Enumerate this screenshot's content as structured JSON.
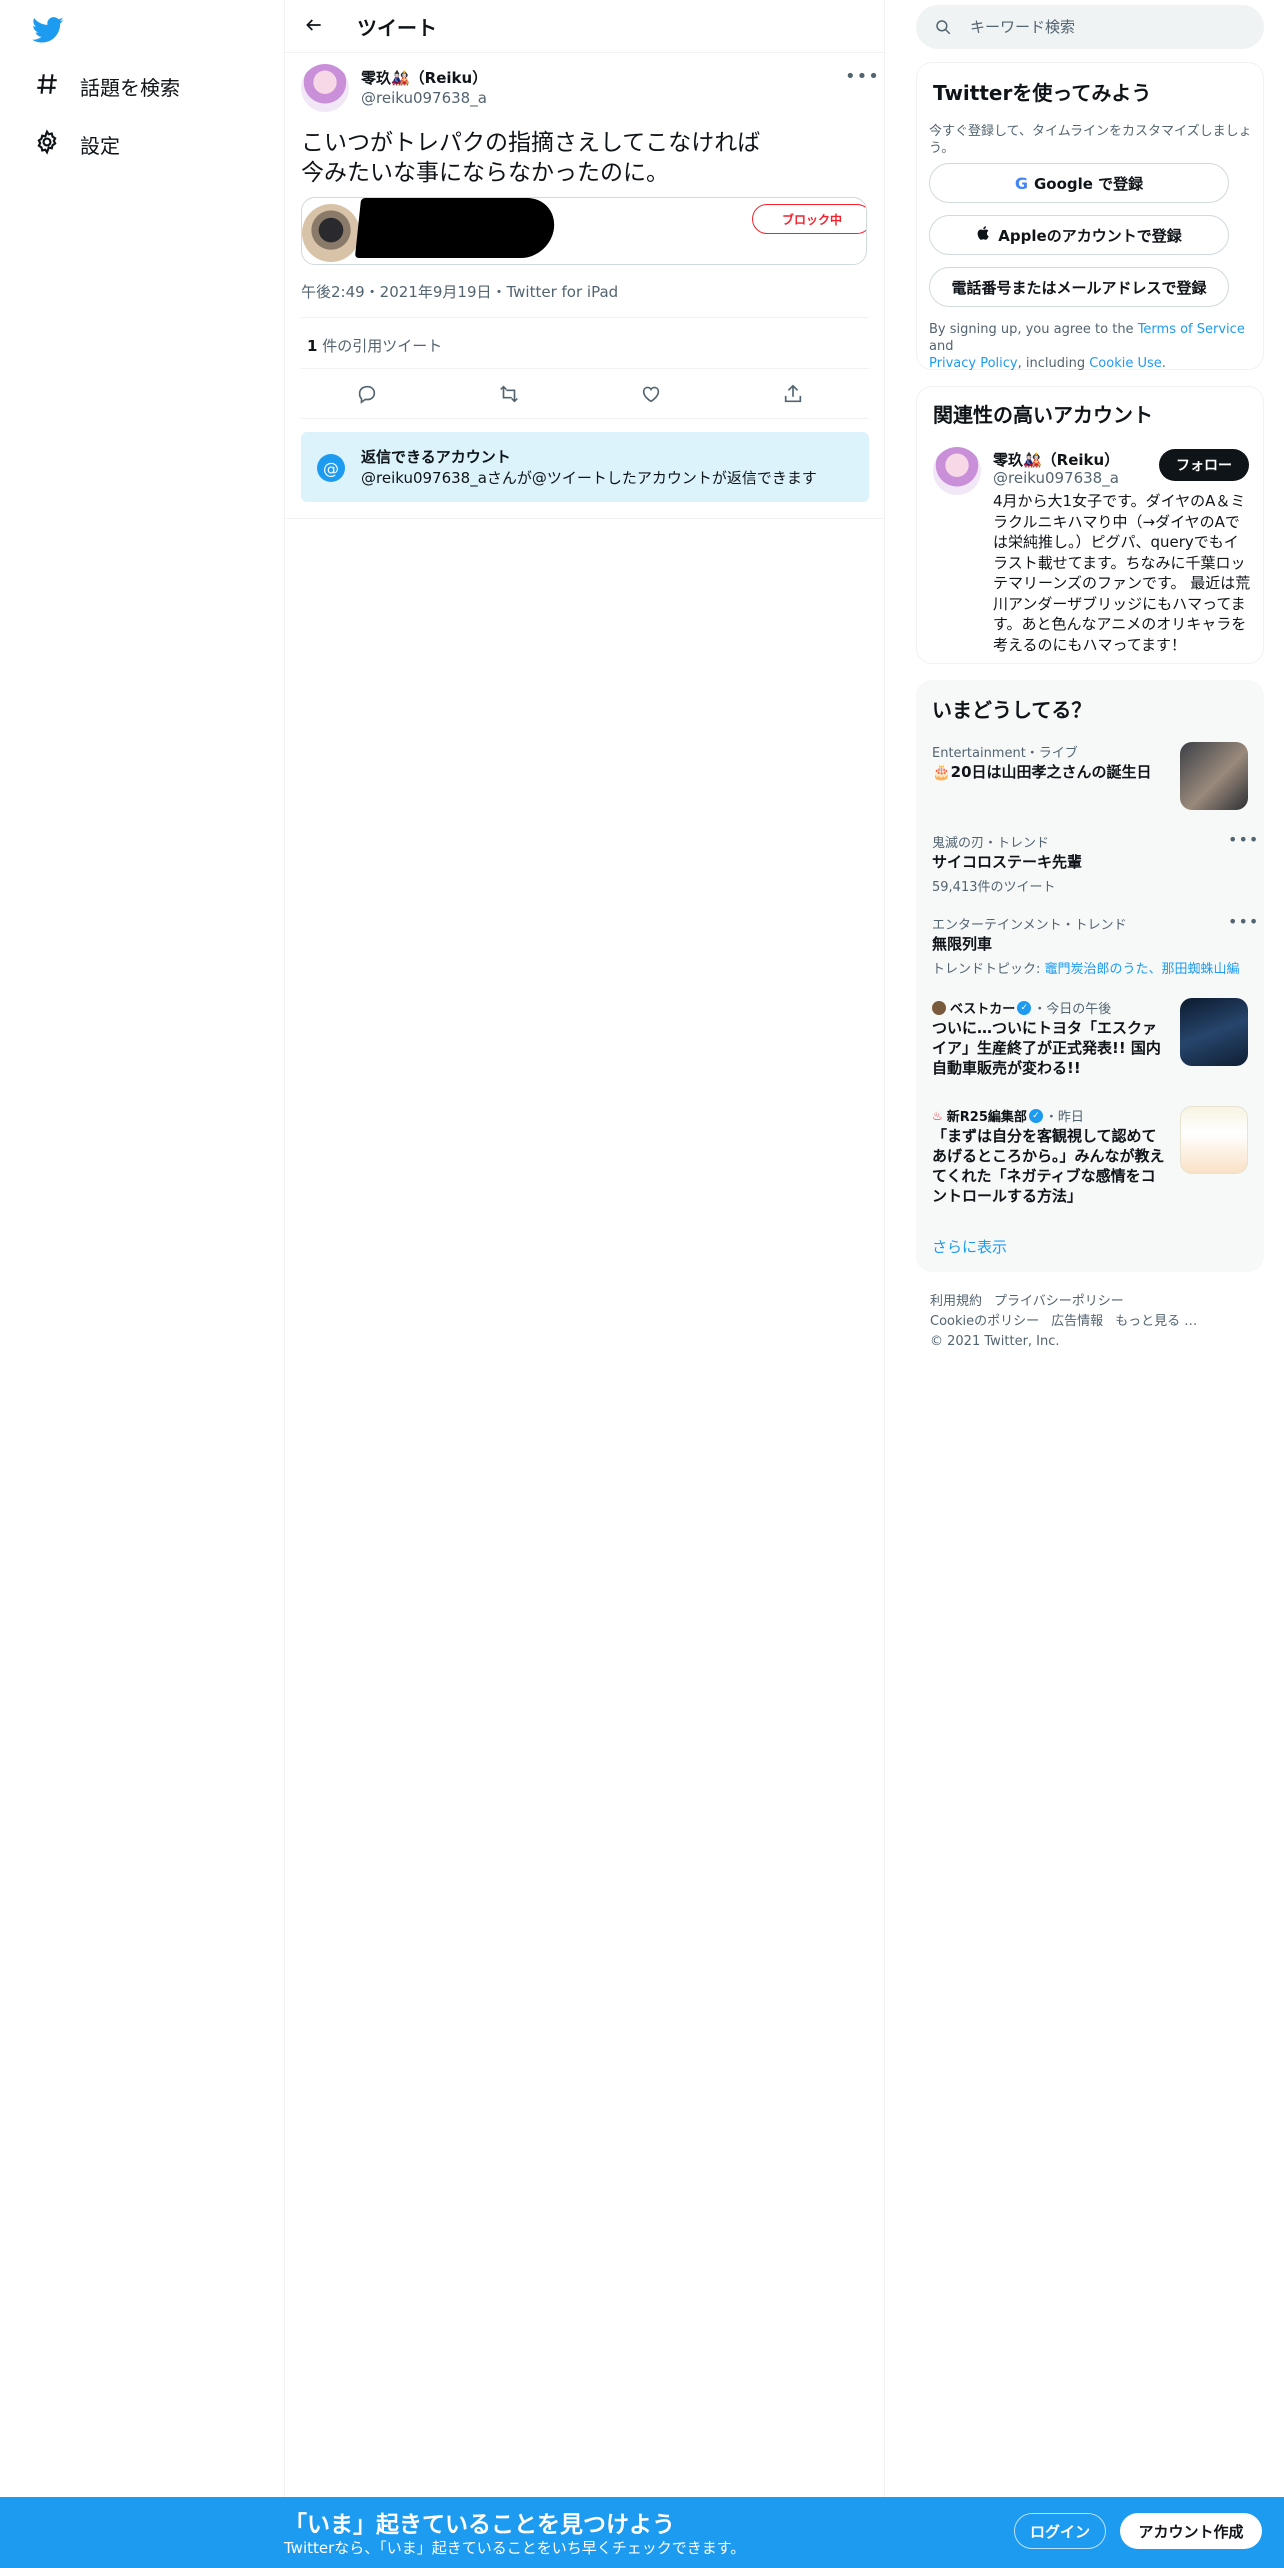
{
  "nav": {
    "explore_label": "話題を検索",
    "settings_label": "設定"
  },
  "header": {
    "title": "ツイート"
  },
  "tweet": {
    "name": "零玖🎎（Reiku）",
    "handle": "@reiku097638_a",
    "text": "こいつがトレパクの指摘さえしてこなければ\n今みたいな事にならなかったのに。",
    "quote_block_label": "ブロック中",
    "meta": "午後2:49・2021年9月19日・Twitter for iPad",
    "quote_count_number": "1",
    "quote_count_label": " 件の引用ツイート"
  },
  "reply_restriction": {
    "icon_text": "@",
    "title": "返信できるアカウント",
    "subtitle": "@reiku097638_aさんが@ツイートしたアカウントが返信できます"
  },
  "search": {
    "placeholder": "キーワード検索"
  },
  "signup_card": {
    "title": "Twitterを使ってみよう",
    "description": "今すぐ登録して、タイムラインをカスタマイズしましょう。",
    "google_g": "G",
    "google_label": "Google で登録",
    "apple_label": "Appleのアカウントで登録",
    "phone_label": "電話番号またはメールアドレスで登録",
    "terms_prefix": "By signing up, you agree to the ",
    "terms_link": "Terms of Service",
    "terms_and": " and ",
    "privacy_link": "Privacy Policy",
    "terms_including": ", including ",
    "cookie_link": "Cookie Use",
    "terms_end": "."
  },
  "related_card": {
    "title": "関連性の高いアカウント",
    "name": "零玖🎎（Reiku）",
    "handle": "@reiku097638_a",
    "follow_label": "フォロー",
    "bio": "4月から大1女子です。ダイヤのA＆ミラクルニキハマり中（→ダイヤのAでは栄純推し。）ピグパ、queryでもイラスト載せてます。ちなみに千葉ロッテマリーンズのファンです。 最近は荒川アンダーザブリッジにもハマってます。あと色んなアニメのオリキャラを考えるのにもハマってます！"
  },
  "trends_card": {
    "title": "いまどうしてる？",
    "items": [
      {
        "meta": "Entertainment・ライブ",
        "title": "🎂20日は山田孝之さんの誕生日"
      },
      {
        "meta": "鬼滅の刃・トレンド",
        "title": "サイコロステーキ先輩",
        "sub": "59,413件のツイート"
      },
      {
        "meta": "エンターテインメント・トレンド",
        "title": "無限列車",
        "sub_prefix": "トレンドトピック: ",
        "sub_links": "竈門炭治郎のうた、那田蜘蛛山編"
      },
      {
        "meta_source": "ベストカー",
        "meta_time": "・今日の午後",
        "title": "ついに…ついにトヨタ「エスクァイア」生産終了が正式発表!! 国内自動車販売が変わる!!"
      },
      {
        "meta_source": "新R25編集部",
        "meta_time": "・昨日",
        "title": "「まずは自分を客観視して認めてあげるところから。」みんなが教えてくれた「ネガティブな感情をコントロールする方法」"
      }
    ],
    "show_more": "さらに表示"
  },
  "footer": {
    "terms": "利用規約",
    "privacy": "プライバシーポリシー",
    "cookie": "Cookieのポリシー",
    "ads": "広告情報",
    "more": "もっと見る …",
    "copyright": "© 2021 Twitter, Inc."
  },
  "bottom_bar": {
    "title": "「いま」起きていることを見つけよう",
    "subtitle": "Twitterなら、「いま」起きていることをいち早くチェックできます。",
    "login_label": "ログイン",
    "signup_label": "アカウント作成"
  },
  "colors": {
    "accent": "#1d9bf0",
    "text": "#0f1419",
    "secondary_text": "#536471",
    "block_red": "#f4212e",
    "reply_box_bg": "#dcf3fc"
  }
}
